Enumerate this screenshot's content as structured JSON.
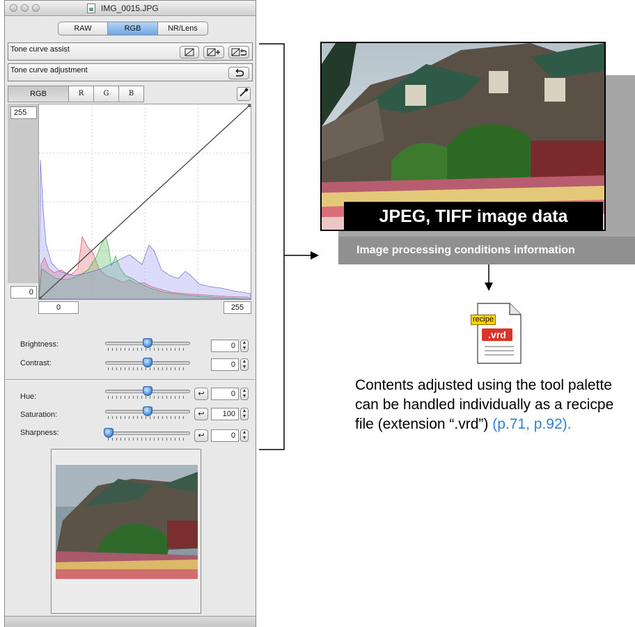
{
  "palette": {
    "window_title": "IMG_0015.JPG",
    "tabs": [
      {
        "label": "RAW",
        "active": false
      },
      {
        "label": "RGB",
        "active": true
      },
      {
        "label": "NR/Lens",
        "active": false
      }
    ],
    "tone_curve_assist_label": "Tone curve assist",
    "tone_curve_adjustment_label": "Tone curve adjustment",
    "channels": [
      "RGB",
      "R",
      "G",
      "B"
    ],
    "active_channel": "RGB",
    "curve": {
      "y_max_label": "255",
      "y_min_label": "0",
      "x_min_label": "0",
      "x_max_label": "255"
    },
    "controls": {
      "brightness": {
        "label": "Brightness:",
        "value": "0"
      },
      "contrast": {
        "label": "Contrast:",
        "value": "0"
      },
      "hue": {
        "label": "Hue:",
        "value": "0"
      },
      "saturation": {
        "label": "Saturation:",
        "value": "100"
      },
      "sharpness": {
        "label": "Sharpness:",
        "value": "0"
      }
    },
    "icons": {
      "assist_linear": "linear-curve-icon",
      "assist_auto": "auto-curve-icon",
      "assist_reset": "reset-curve-icon",
      "reset": "undo-arrow-icon",
      "eyedropper": "eyedropper-icon",
      "stepper": "up-down-stepper-icon"
    },
    "colors": {
      "active_tab": "#6fa6e4",
      "slider_knob": "#3f86d8"
    }
  },
  "diagram": {
    "image_label": "JPEG, TIFF image data",
    "conditions_label": "Image processing conditions information",
    "recipe_tag": "recipe",
    "recipe_ext": ".vrd",
    "description_text": "Contents adjusted using the tool palette can be handled individually as a recicpe file (extension “.vrd”) ",
    "description_ref": "(p.71, p.92).",
    "colors": {
      "reference_link": "#2f7fd8",
      "recipe_tag_bg": "#ffd200",
      "recipe_ext_bg": "#d9352a"
    }
  }
}
